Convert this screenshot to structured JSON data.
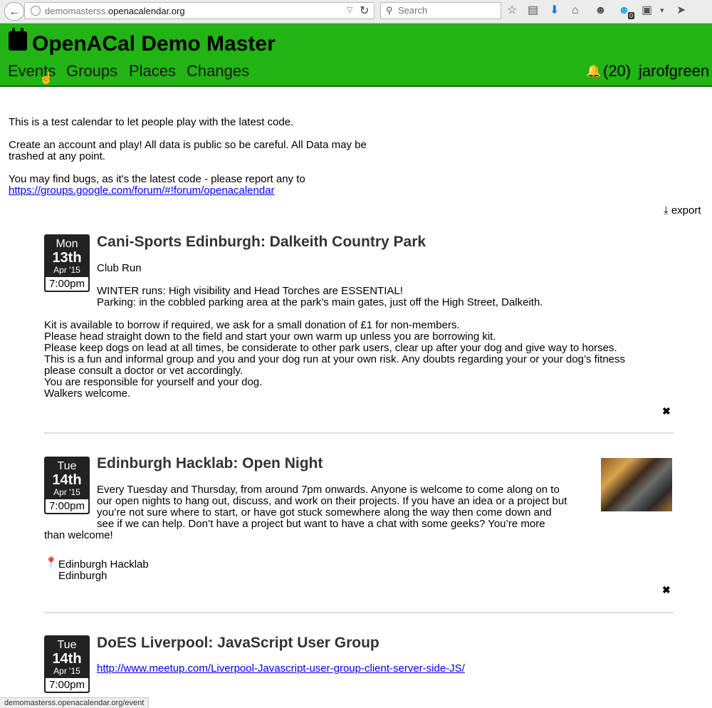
{
  "browser": {
    "url_prefix": "demomasterss.",
    "url_domain": "openacalendar.org",
    "search_placeholder": "Search",
    "badge_count": "0",
    "status_url": "demomasterss.openacalendar.org/event"
  },
  "site": {
    "title": "OpenACal Demo Master",
    "nav": [
      "Events",
      "Groups",
      "Places",
      "Changes"
    ],
    "notifications": "(20)",
    "username": "jarofgreen"
  },
  "intro": {
    "p1": "This is a test calendar to let people play with the latest code.",
    "p2_line1": "Create an account and play! All data is public so be careful. All Data may be",
    "p2_line2": "trashed at any point.",
    "p3_line1": "You may find bugs, as it's the latest code - please report any to",
    "p3_link": "https://groups.google.com/forum/#!forum/openacalendar"
  },
  "export_label": "export",
  "events": [
    {
      "dow": "Mon",
      "day": "13th",
      "month": "Apr '15",
      "time": "7:00pm",
      "title": "Cani-Sports Edinburgh: Dalkeith Country Park",
      "lines": [
        "Club Run",
        "WINTER runs: High visibility and Head Torches are ESSENTIAL!",
        "Parking: in the cobbled parking area at the park’s main gates, just off the High Street, Dalkeith.",
        "Kit is available to borrow if required, we ask for a small donation of £1 for non-members.",
        "Please head straight down to the field and start your own warm up unless you are borrowing kit.",
        "Please keep dogs on lead at all times, be considerate to other park users, clear up after your dog and give way to horses.",
        "This is a fun and informal group and you and your dog run at your own risk. Any doubts regarding your or your dog’s fitness",
        "please consult a doctor or vet accordingly.",
        "You are responsible for yourself and your dog.",
        "Walkers welcome."
      ]
    },
    {
      "dow": "Tue",
      "day": "14th",
      "month": "Apr '15",
      "time": "7:00pm",
      "title": "Edinburgh Hacklab: Open Night",
      "lines": [
        "Every Tuesday and Thursday, from around 7pm onwards. Anyone is welcome to come along on to",
        "our open nights to hang out, discuss, and work on their projects. If you have an idea or a project but",
        "you’re not sure where to start, or have got stuck somewhere along the way then come down and",
        "see if we can help. Don’t have a project but want to have a chat with some geeks? You’re more",
        "than welcome!"
      ],
      "venue": "Edinburgh Hacklab",
      "area": "Edinburgh"
    },
    {
      "dow": "Tue",
      "day": "14th",
      "month": "Apr '15",
      "time": "7:00pm",
      "title": "DoES Liverpool: JavaScript User Group",
      "link": "http://www.meetup.com/Liverpool-Javascript-user-group-client-server-side-JS/"
    }
  ],
  "icons": {
    "back": "back-arrow-icon",
    "reload": "reload-icon",
    "search": "search-icon",
    "bell": "bell-icon",
    "export": "download-icon",
    "hide": "close-icon",
    "pin": "map-pin-icon"
  }
}
